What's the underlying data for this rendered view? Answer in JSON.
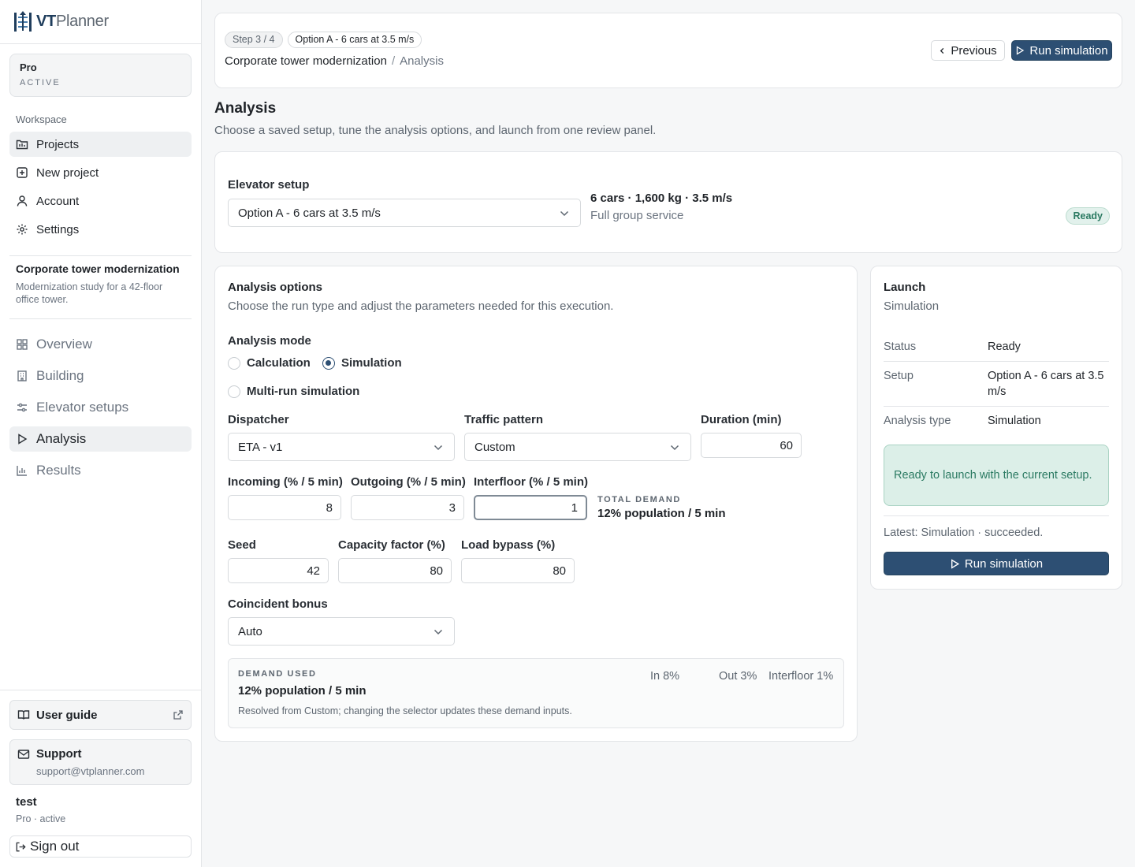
{
  "app": {
    "logo_a": "VT",
    "logo_b": "Planner"
  },
  "plan": {
    "name": "Pro",
    "status": "ACTIVE"
  },
  "workspace": {
    "label": "Workspace",
    "items": [
      {
        "label": "Projects",
        "active": true
      },
      {
        "label": "New project"
      },
      {
        "label": "Account"
      },
      {
        "label": "Settings"
      }
    ]
  },
  "project": {
    "title": "Corporate tower modernization",
    "description": "Modernization study for a 42-floor office tower.",
    "nav": [
      {
        "label": "Overview"
      },
      {
        "label": "Building"
      },
      {
        "label": "Elevator setups"
      },
      {
        "label": "Analysis",
        "active": true
      },
      {
        "label": "Results"
      }
    ]
  },
  "footer": {
    "guide": "User guide",
    "support_title": "Support",
    "support_email": "support@vtplanner.com",
    "user_name": "test",
    "user_plan": "Pro · active",
    "signout": "Sign out"
  },
  "header": {
    "step": "Step 3 / 4",
    "option_pill": "Option A - 6 cars at 3.5 m/s",
    "crumb_project": "Corporate tower modernization",
    "crumb_sep": "/",
    "crumb_current": "Analysis",
    "previous": "Previous",
    "run": "Run simulation"
  },
  "page": {
    "title": "Analysis",
    "subtitle": "Choose a saved setup, tune the analysis options, and launch from one review panel."
  },
  "setup": {
    "label": "Elevator setup",
    "selected": "Option A - 6 cars at 3.5 m/s",
    "spec": "6 cars · 1,600 kg · 3.5 m/s",
    "service": "Full group service",
    "badge": "Ready"
  },
  "options": {
    "title": "Analysis options",
    "subtitle": "Choose the run type and adjust the parameters needed for this execution.",
    "mode_label": "Analysis mode",
    "modes": [
      "Calculation",
      "Simulation",
      "Multi-run simulation"
    ],
    "mode_selected": "Simulation",
    "dispatcher_label": "Dispatcher",
    "dispatcher": "ETA - v1",
    "traffic_label": "Traffic pattern",
    "traffic": "Custom",
    "duration_label": "Duration (min)",
    "duration": "60",
    "incoming_label": "Incoming (% / 5 min)",
    "incoming": "8",
    "outgoing_label": "Outgoing (% / 5 min)",
    "outgoing": "3",
    "interfloor_label": "Interfloor (% / 5 min)",
    "interfloor": "1",
    "total_label": "TOTAL DEMAND",
    "total_value": "12% population / 5 min",
    "seed_label": "Seed",
    "seed": "42",
    "capacity_label": "Capacity factor (%)",
    "capacity": "80",
    "bypass_label": "Load bypass (%)",
    "bypass": "80",
    "coincident_label": "Coincident bonus",
    "coincident": "Auto",
    "demand_caps": "DEMAND USED",
    "demand_value": "12% population / 5 min",
    "demand_in": "In 8%",
    "demand_out": "Out 3%",
    "demand_inter": "Interfloor 1%",
    "demand_note": "Resolved from Custom; changing the selector updates these demand inputs."
  },
  "launch": {
    "title": "Launch",
    "subtitle": "Simulation",
    "rows": [
      {
        "key": "Status",
        "value": "Ready"
      },
      {
        "key": "Setup",
        "value": "Option A - 6 cars at 3.5 m/s"
      },
      {
        "key": "Analysis type",
        "value": "Simulation"
      }
    ],
    "notice": "Ready to launch with the current setup.",
    "latest": "Latest: Simulation · succeeded.",
    "run": "Run simulation"
  },
  "colors": {
    "primary": "#2d4f73",
    "success_bg": "#dcefe8",
    "success_text": "#2b7a62"
  }
}
